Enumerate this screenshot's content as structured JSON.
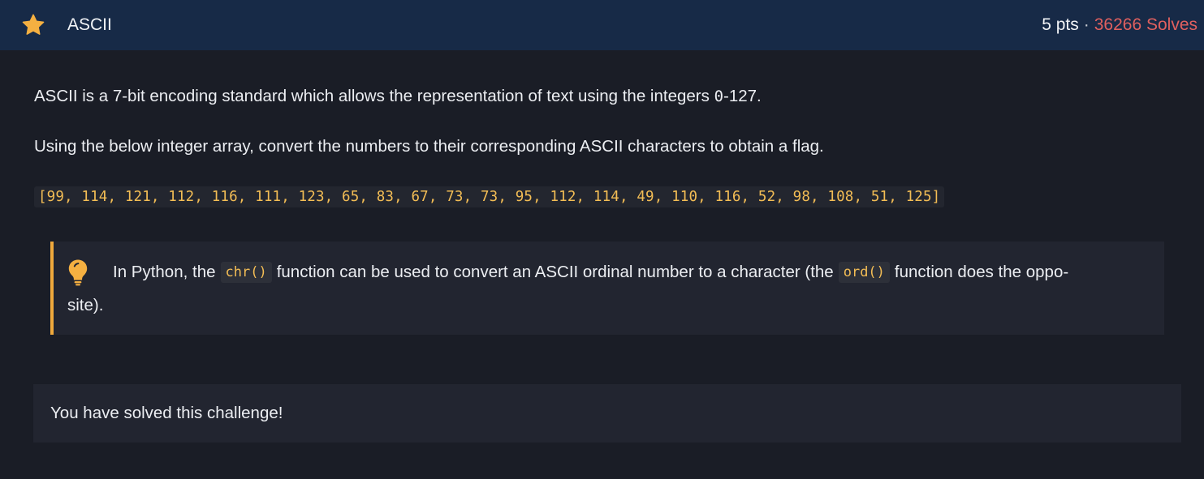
{
  "header": {
    "title": "ASCII",
    "points": "5 pts",
    "separator": "·",
    "solves": "36266 Solves",
    "star_color": "#f5b041",
    "solves_color": "#e0605f"
  },
  "description": {
    "p1_before": "ASCII is a 7-bit encoding standard which allows the representation of text using the integers ",
    "p1_code": "0",
    "p1_after": "-127.",
    "p2": "Using the below integer array, convert the numbers to their corresponding ASCII characters to obtain a flag.",
    "array": "[99, 114, 121, 112, 116, 111, 123, 65, 83, 67, 73, 73, 95, 112, 114, 49, 110, 116, 52, 98, 108, 51, 125]"
  },
  "hint": {
    "icon": "lightbulb-icon",
    "text_before": "In Python, the",
    "code1": "chr()",
    "text_middle": "function can be used to convert an ASCII ordinal number to a character (the",
    "code2": "ord()",
    "text_after": "function does the oppo-",
    "text_line2": "site).",
    "accent_color": "#f0a93c"
  },
  "status": {
    "message": "You have solved this challenge!"
  }
}
